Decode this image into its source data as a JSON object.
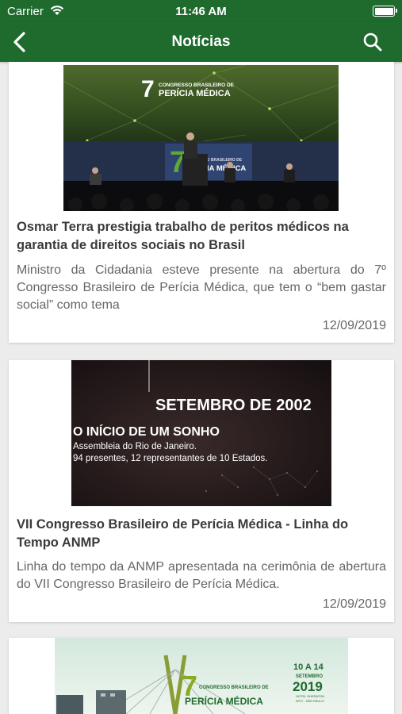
{
  "status_bar": {
    "carrier": "Carrier",
    "time": "11:46 AM"
  },
  "nav": {
    "title": "Notícias",
    "back_icon": "chevron-left-icon",
    "search_icon": "search-icon"
  },
  "theme": {
    "primary": "#1f6b2e",
    "background": "#ececec"
  },
  "news": [
    {
      "title": "Osmar Terra prestigia trabalho de peritos médicos na garantia de direitos sociais no Brasil",
      "description": "Ministro da Cidadania esteve presente na abertura do 7º Congresso Brasileiro de Perícia Médica, que tem o “bem gastar social” como tema",
      "date": "12/09/2019",
      "image": {
        "n": "7",
        "line1": "CONGRESSO BRASILEIRO DE",
        "line2": "PERÍCIA MÉDICA",
        "screen_n": "7",
        "screen1": "CONGRESSO BRASILEIRO DE",
        "screen2": "PERÍCIA MÉDICA"
      }
    },
    {
      "title": "VII Congresso Brasileiro de Perícia Médica - Linha do Tempo ANMP",
      "description": "Linha do tempo da ANMP apresentada na cerimônia de abertura do VII Congresso Brasileiro de Perícia Médica.",
      "date": "12/09/2019",
      "image": {
        "heading": "SETEMBRO DE 2002",
        "subheading": "O INÍCIO DE UM SONHO",
        "line1": "Assembleia do Rio de Janeiro.",
        "line2": "94 presentes, 12 representantes de 10 Estados."
      }
    },
    {
      "image": {
        "n": "7",
        "line1": "CONGRESSO BRASILEIRO DE",
        "line2": "PERÍCIA MÉDICA",
        "days": "10 A 14",
        "month": "SETEMBRO",
        "year": "2019",
        "venue": "HOTEL SHERATON",
        "city": "WTC - SÃO PAULO"
      }
    }
  ]
}
